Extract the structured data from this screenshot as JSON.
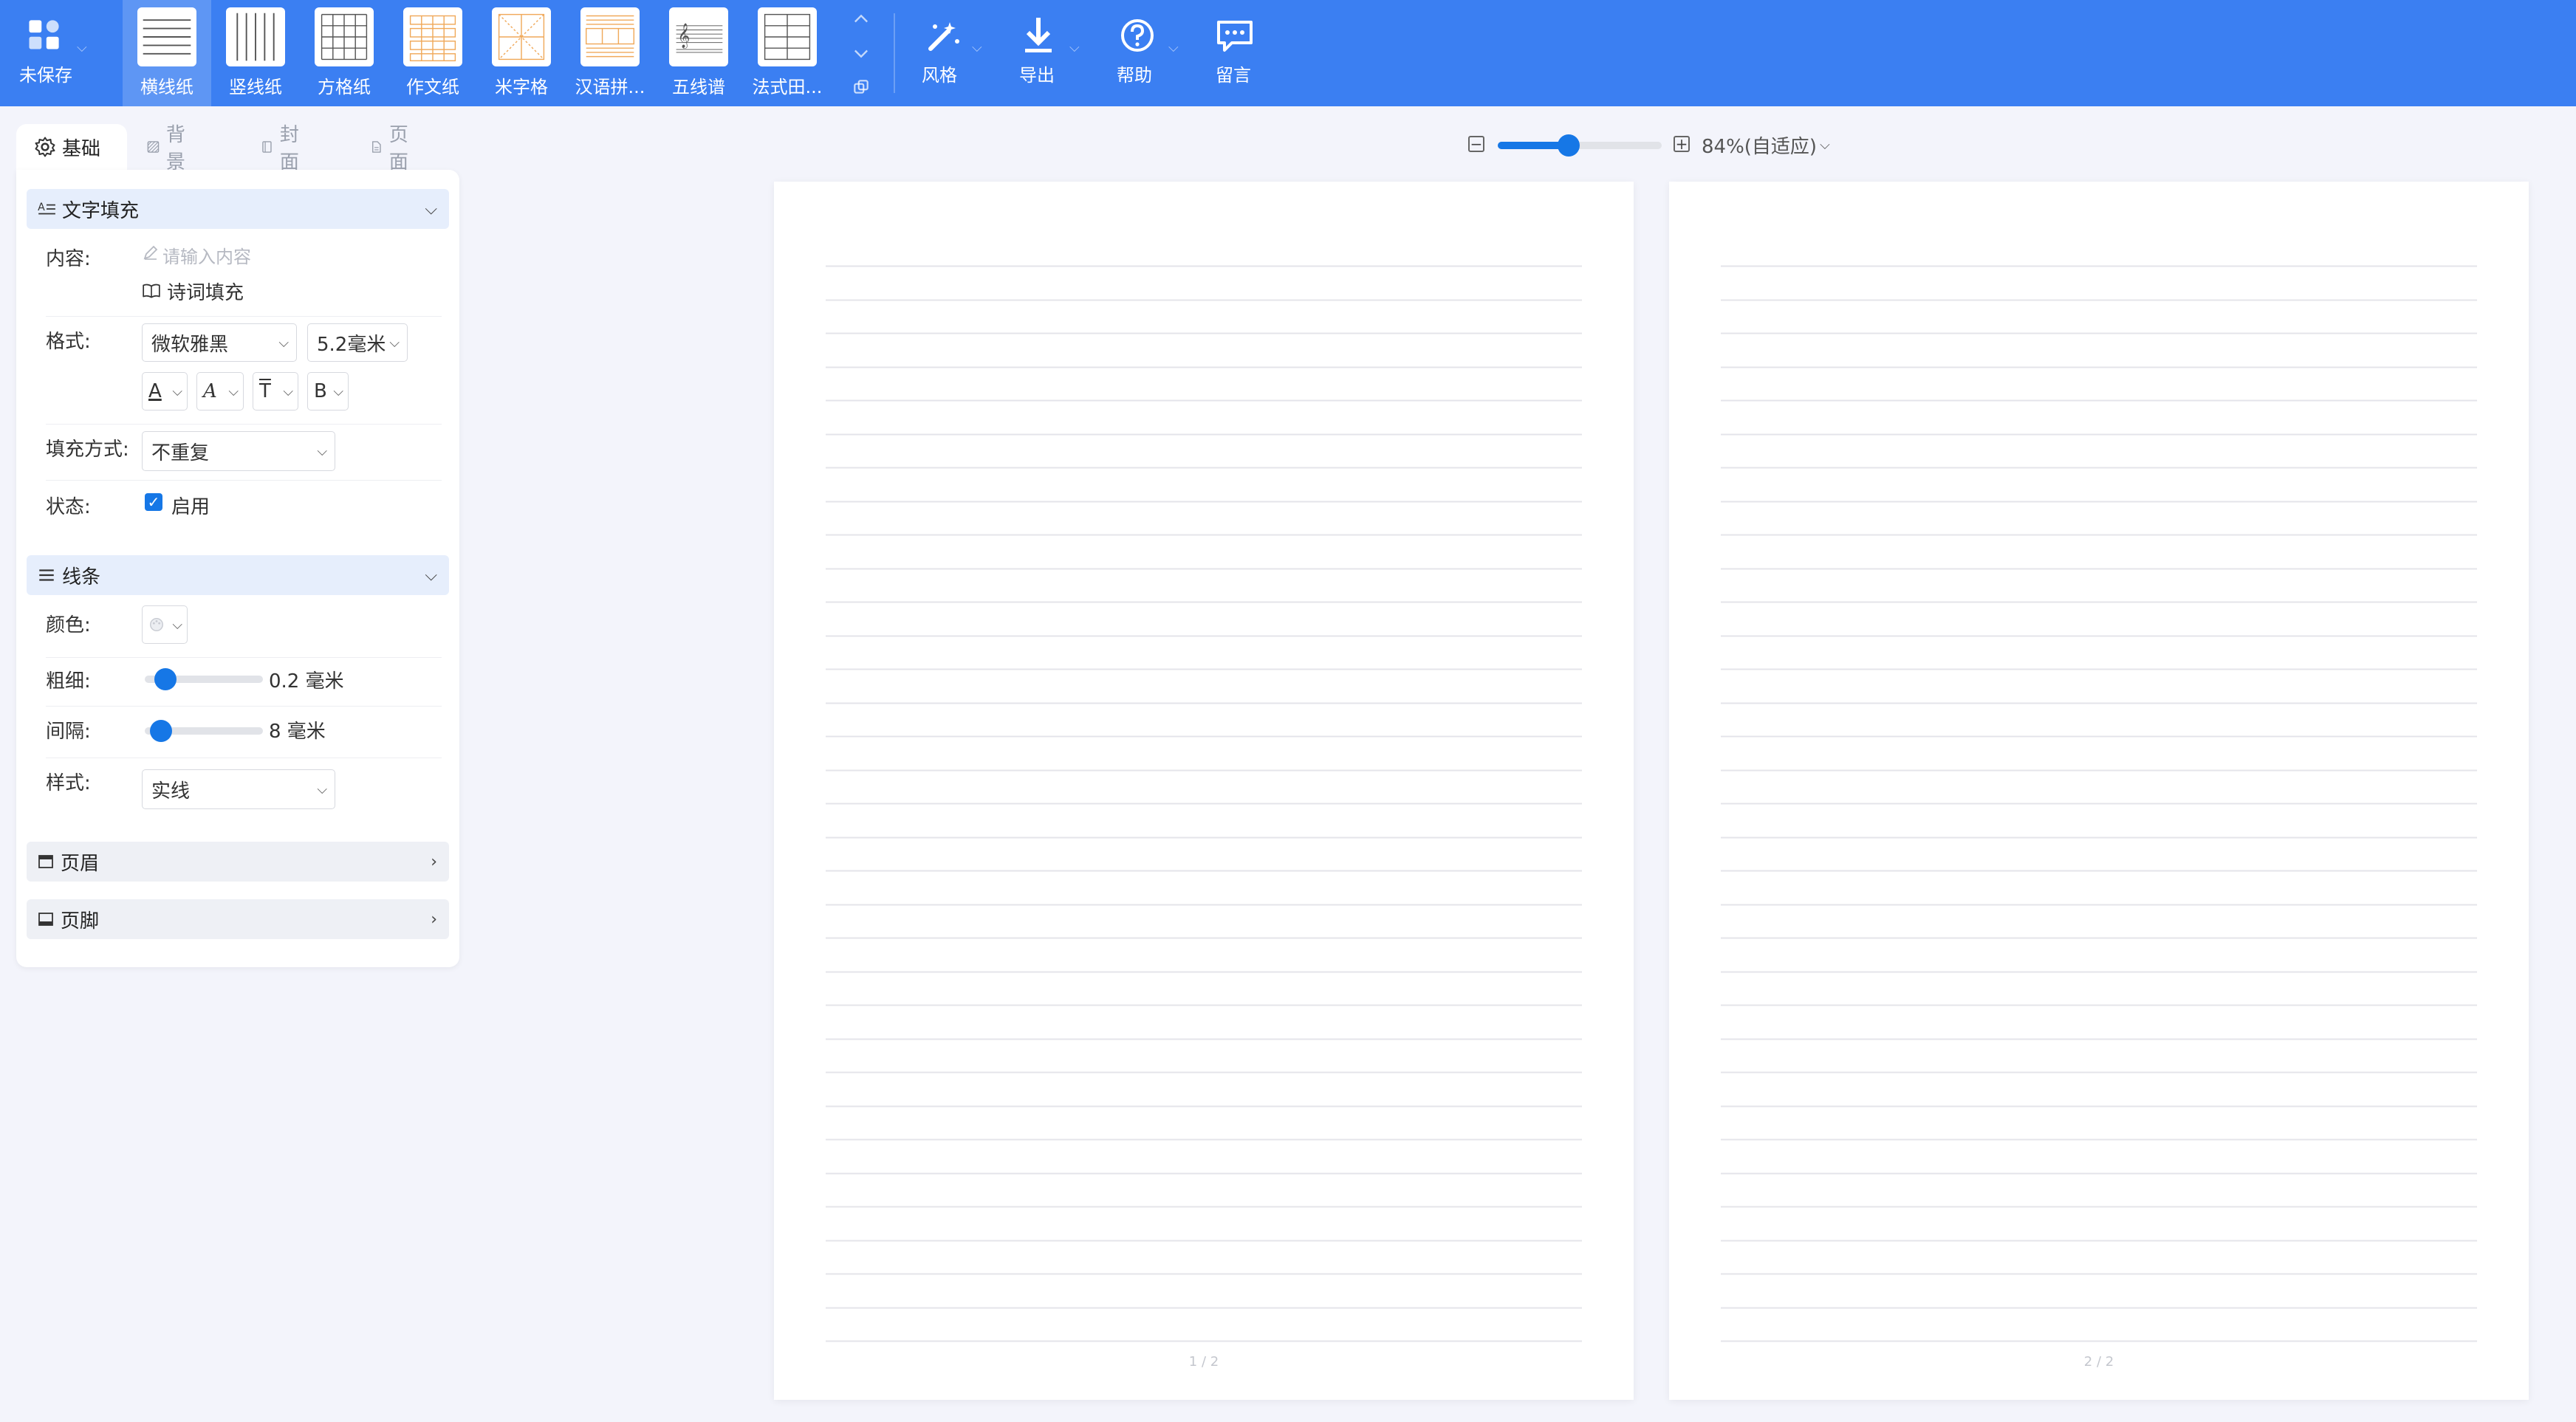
{
  "toolbar": {
    "unsaved_label": "未保存",
    "paper_types": [
      {
        "label": "横线纸",
        "active": true
      },
      {
        "label": "竖线纸",
        "active": false
      },
      {
        "label": "方格纸",
        "active": false
      },
      {
        "label": "作文纸",
        "active": false
      },
      {
        "label": "米字格",
        "active": false
      },
      {
        "label": "汉语拼...",
        "active": false
      },
      {
        "label": "五线谱",
        "active": false
      },
      {
        "label": "法式田...",
        "active": false
      }
    ],
    "style_label": "风格",
    "export_label": "导出",
    "help_label": "帮助",
    "feedback_label": "留言"
  },
  "tabs": [
    {
      "label": "基础",
      "active": true
    },
    {
      "label": "背景",
      "active": false
    },
    {
      "label": "封面",
      "active": false
    },
    {
      "label": "页面",
      "active": false
    }
  ],
  "text_fill": {
    "title": "文字填充",
    "content_label": "内容:",
    "content_placeholder": "请输入内容",
    "poem_fill_label": "诗词填充",
    "format_label": "格式:",
    "font_value": "微软雅黑",
    "size_value": "5.2毫米",
    "font_color_btn": "A",
    "font_style_btn": "A",
    "align_btn": "T",
    "bold_btn": "B",
    "fill_mode_label": "填充方式:",
    "fill_mode_value": "不重复",
    "status_label": "状态:",
    "enabled_label": "启用",
    "enabled": true
  },
  "lines": {
    "title": "线条",
    "color_label": "颜色:",
    "thickness_label": "粗细:",
    "thickness_value": "0.2 毫米",
    "thickness_level": 0.1,
    "spacing_label": "间隔:",
    "spacing_value": "8 毫米",
    "spacing_level": 0.05,
    "style_label": "样式:",
    "style_value": "实线"
  },
  "header_section": {
    "title": "页眉"
  },
  "footer_section": {
    "title": "页脚"
  },
  "zoom": {
    "value_label": "84%(自适应)",
    "level": 0.42
  },
  "pages": [
    {
      "number_label": "1 / 2",
      "line_count": 33
    },
    {
      "number_label": "2 / 2",
      "line_count": 33
    }
  ],
  "colors": {
    "brand": "#3b7ff2",
    "accent": "#1677e6",
    "line": "#e4e4ea"
  }
}
